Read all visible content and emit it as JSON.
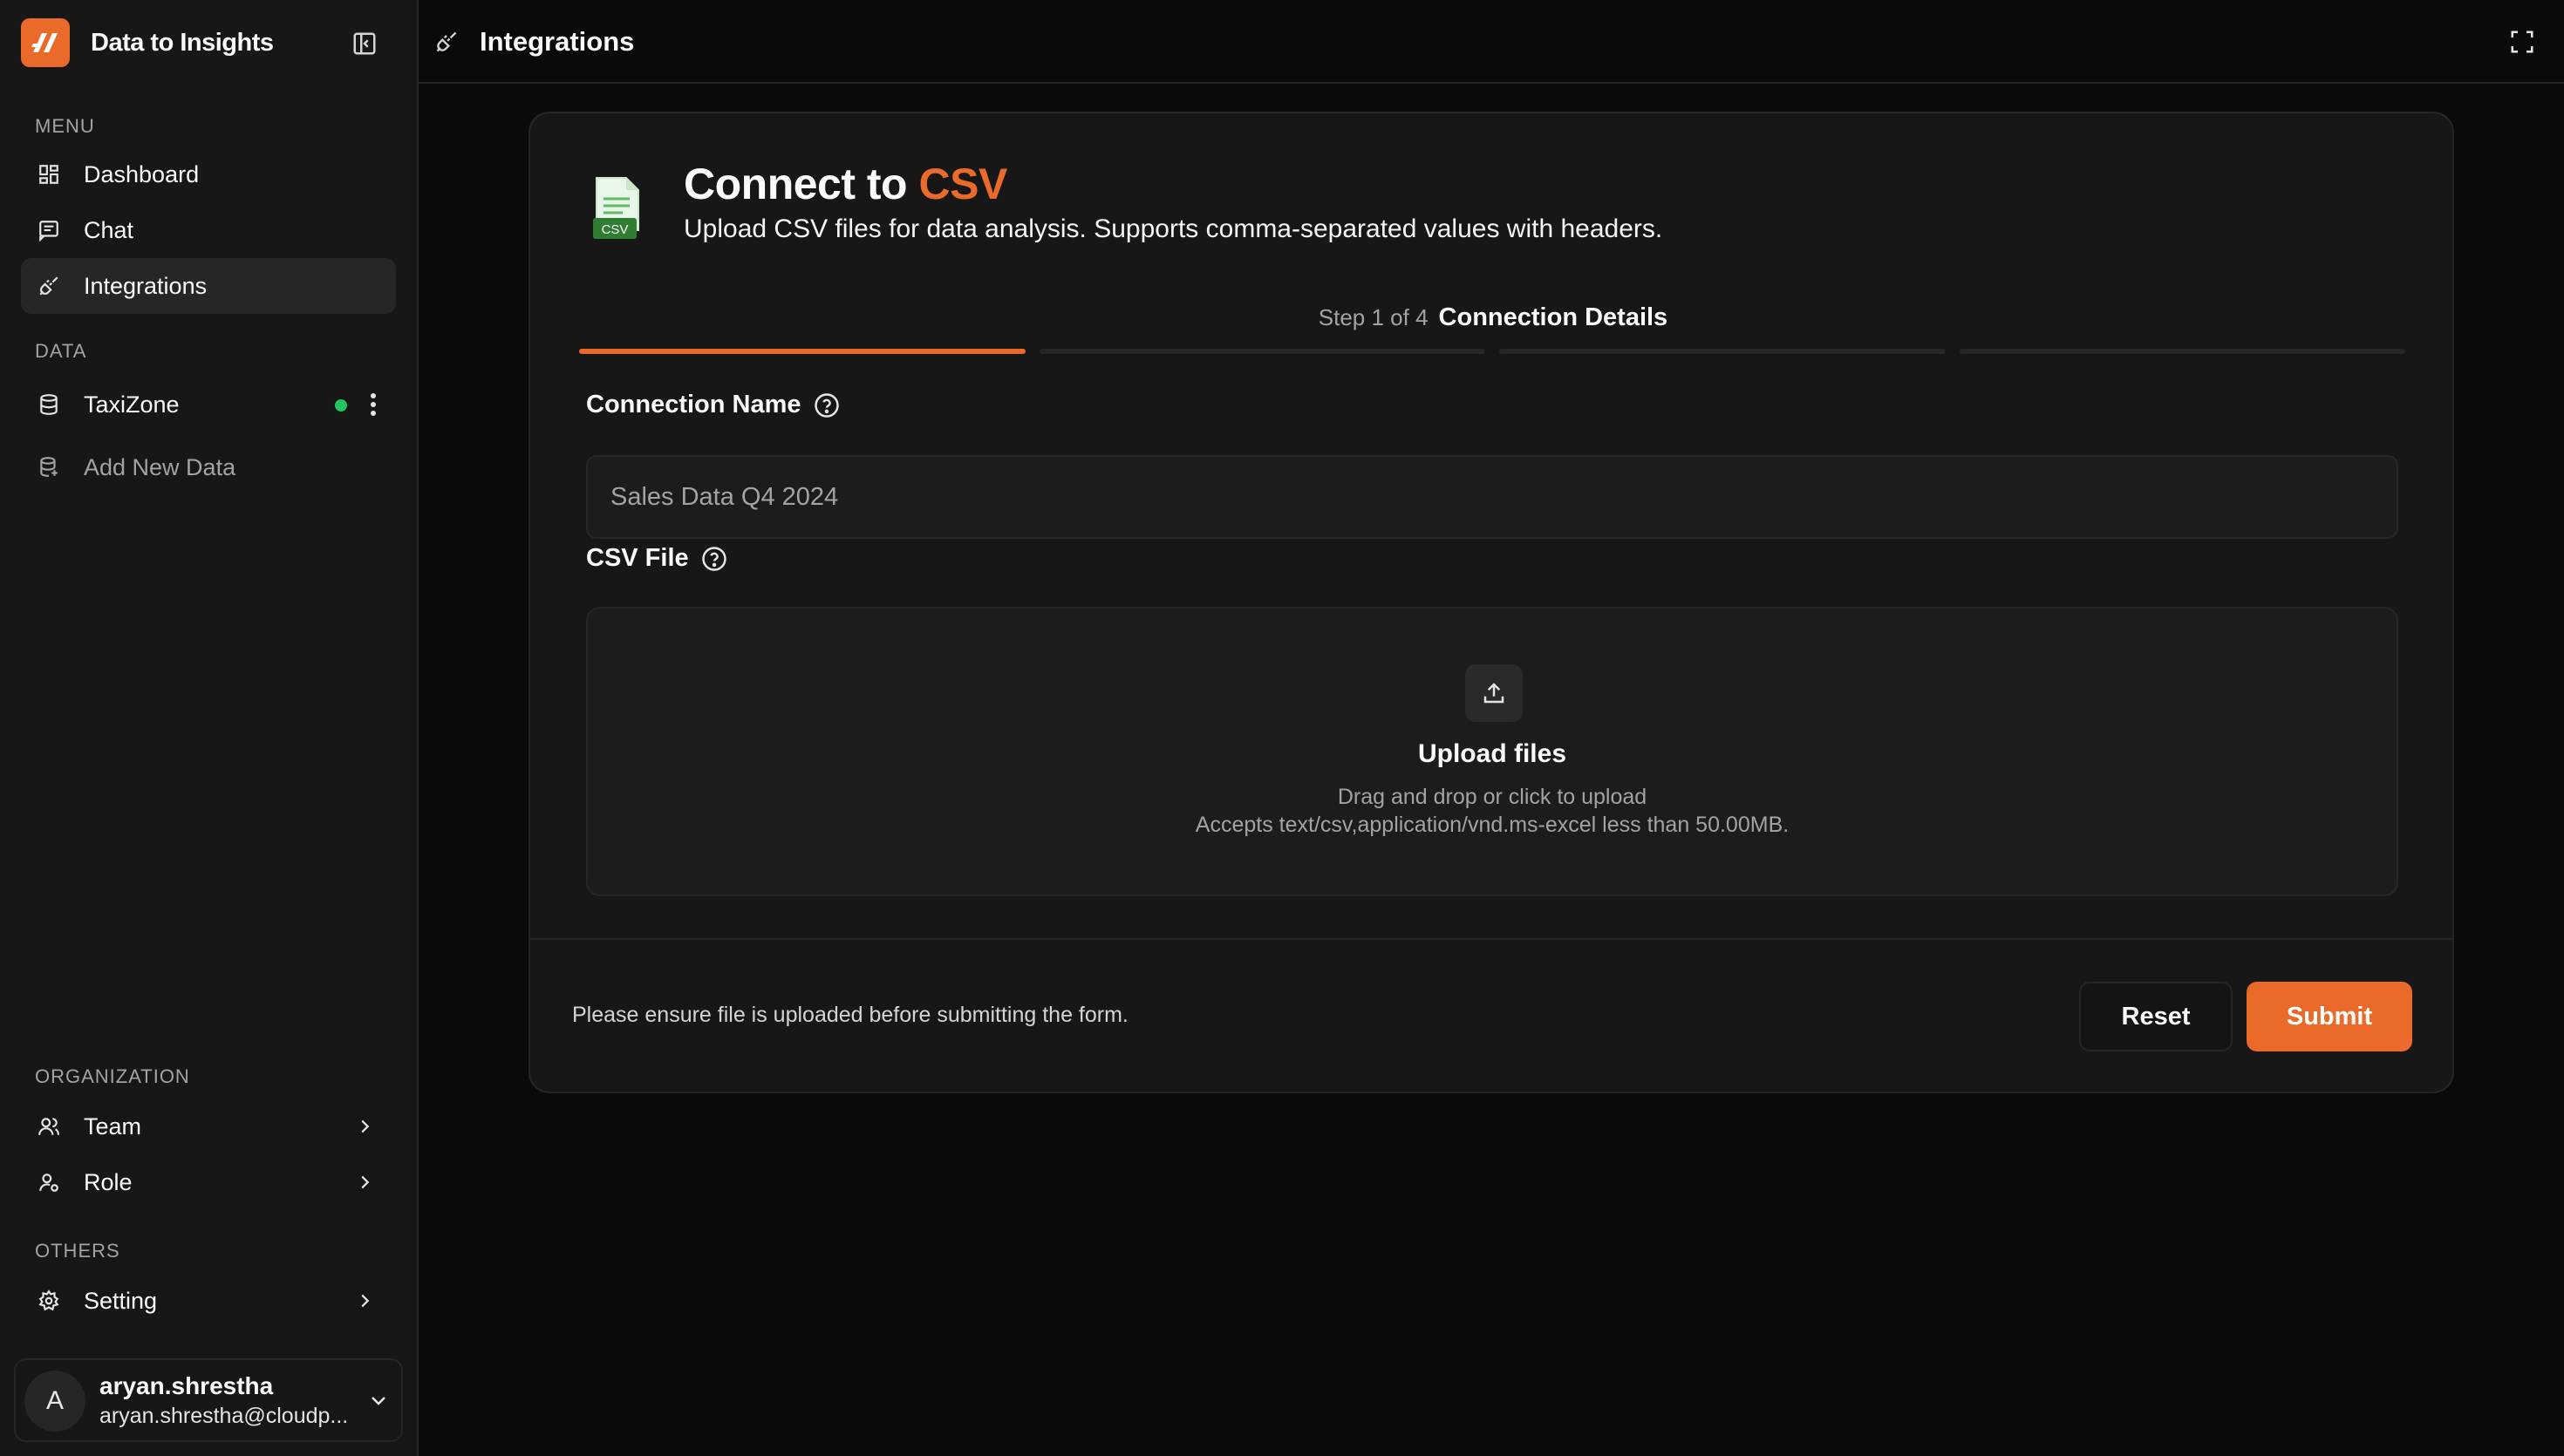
{
  "app": {
    "name": "Data to Insights"
  },
  "sidebar": {
    "menu_label": "MENU",
    "menu_items": [
      {
        "label": "Dashboard"
      },
      {
        "label": "Chat"
      },
      {
        "label": "Integrations"
      }
    ],
    "data_label": "DATA",
    "data_items": [
      {
        "label": "TaxiZone",
        "status": "online"
      },
      {
        "label": "Add New Data"
      }
    ],
    "organization_label": "ORGANIZATION",
    "organization_items": [
      {
        "label": "Team"
      },
      {
        "label": "Role"
      }
    ],
    "others_label": "OTHERS",
    "others_items": [
      {
        "label": "Setting"
      }
    ],
    "user": {
      "initial": "A",
      "name": "aryan.shrestha",
      "email": "aryan.shrestha@cloudp..."
    }
  },
  "topbar": {
    "title": "Integrations"
  },
  "form": {
    "title_prefix": "Connect to ",
    "title_accent": "CSV",
    "icon_label": "CSV",
    "subtitle": "Upload CSV files for data analysis. Supports comma-separated values with headers.",
    "step_count": "Step 1 of 4",
    "step_name": "Connection Details",
    "connection_name_label": "Connection Name",
    "connection_name_placeholder": "Sales Data Q4 2024",
    "csv_file_label": "CSV File",
    "upload_title": "Upload files",
    "upload_hint": "Drag and drop or click to upload",
    "upload_accept": "Accepts text/csv,application/vnd.ms-excel less than 50.00MB.",
    "footer_note": "Please ensure file is uploaded before submitting the form.",
    "reset_label": "Reset",
    "submit_label": "Submit"
  },
  "colors": {
    "accent": "#ea6a2a",
    "status_online": "#22c55e"
  }
}
